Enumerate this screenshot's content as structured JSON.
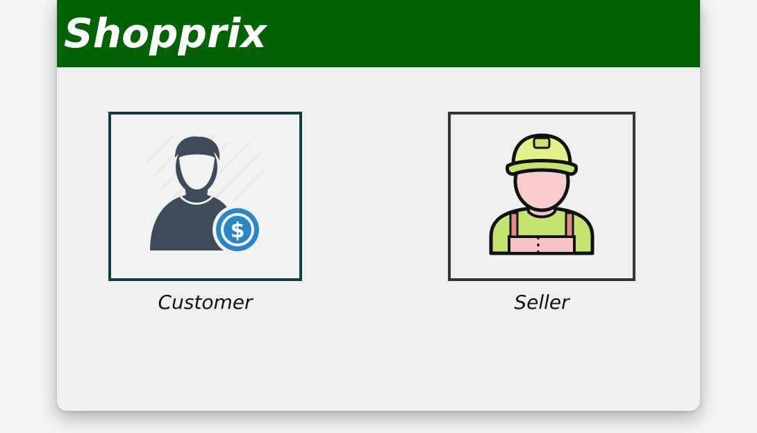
{
  "app": {
    "title": "Shopprix"
  },
  "roles": [
    {
      "id": "customer",
      "label": "Customer",
      "icon": "customer-dollar-icon"
    },
    {
      "id": "seller",
      "label": "Seller",
      "icon": "seller-worker-icon"
    }
  ],
  "colors": {
    "header": "#036203",
    "background": "#efefef",
    "customer_border": "#103e3e",
    "seller_border": "#333333",
    "dollar_badge": "#2a87c7"
  }
}
